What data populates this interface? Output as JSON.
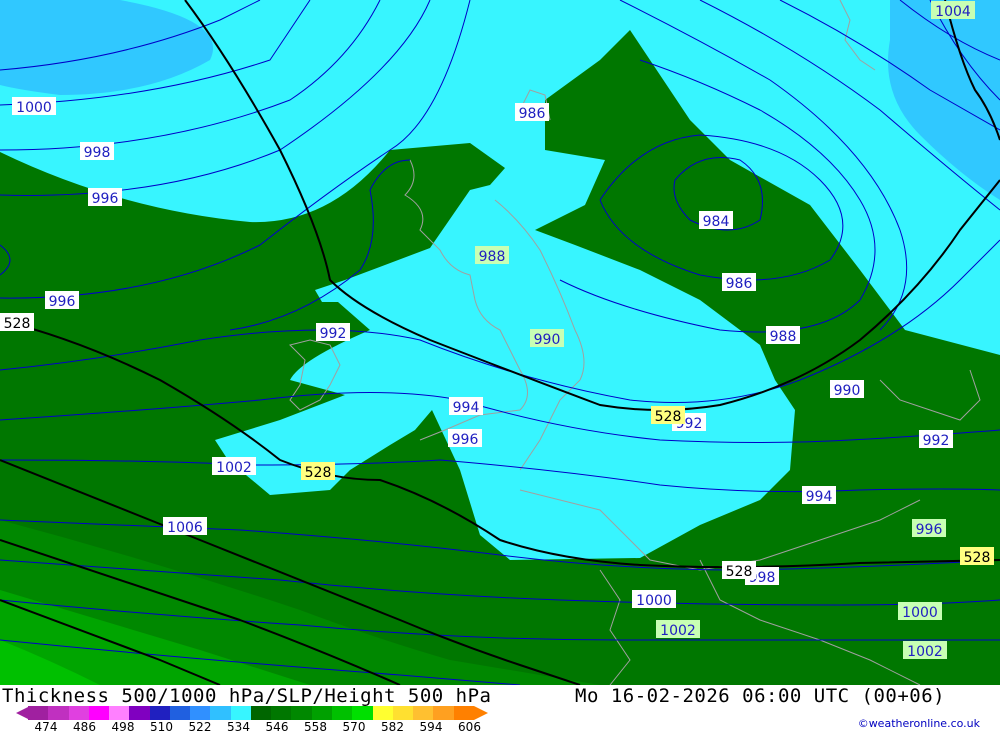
{
  "title": "Thickness 500/1000 hPa/SLP/Height 500 hPa",
  "datetime": "Mo 16-02-2026 06:00 UTC (00+06)",
  "credit": "©weatheronline.co.uk",
  "colors": {
    "thickness_below_528": "#37f5ff",
    "thickness_low_cyan": "#30c8ff",
    "thickness_528_534": "#007700",
    "thickness_534_546": "#008800",
    "thickness_546_558": "#00a500",
    "isobar": "#0000c8",
    "height_500": "#000000",
    "coastline": "#a0a0a0"
  },
  "legend": {
    "ticks": [
      "474",
      "486",
      "498",
      "510",
      "522",
      "534",
      "546",
      "558",
      "570",
      "582",
      "594",
      "606"
    ],
    "colors": [
      "#a020a0",
      "#c030c0",
      "#e040e0",
      "#ff00ff",
      "#ff80ff",
      "#8000c0",
      "#2020c0",
      "#2060e0",
      "#3090ff",
      "#30c0ff",
      "#37f5ff",
      "#006600",
      "#007700",
      "#008800",
      "#00a000",
      "#00c000",
      "#00e000",
      "#ffff30",
      "#ffe030",
      "#ffc030",
      "#ffa020",
      "#ff8000"
    ]
  },
  "labels": {
    "isobars": [
      {
        "text": "1000"
      },
      {
        "text": "998"
      },
      {
        "text": "996"
      },
      {
        "text": "996"
      },
      {
        "text": "986"
      },
      {
        "text": "988"
      },
      {
        "text": "984"
      },
      {
        "text": "986"
      },
      {
        "text": "992"
      },
      {
        "text": "990"
      },
      {
        "text": "988"
      },
      {
        "text": "990"
      },
      {
        "text": "994"
      },
      {
        "text": "996"
      },
      {
        "text": "992"
      },
      {
        "text": "992"
      },
      {
        "text": "1002"
      },
      {
        "text": "1006"
      },
      {
        "text": "994"
      },
      {
        "text": "996"
      },
      {
        "text": "998"
      },
      {
        "text": "1000"
      },
      {
        "text": "1000"
      },
      {
        "text": "1002"
      },
      {
        "text": "1002"
      },
      {
        "text": "1004"
      }
    ],
    "heights": [
      {
        "text": "528"
      },
      {
        "text": "528"
      },
      {
        "text": "528"
      },
      {
        "text": "528"
      },
      {
        "text": "528"
      }
    ]
  }
}
